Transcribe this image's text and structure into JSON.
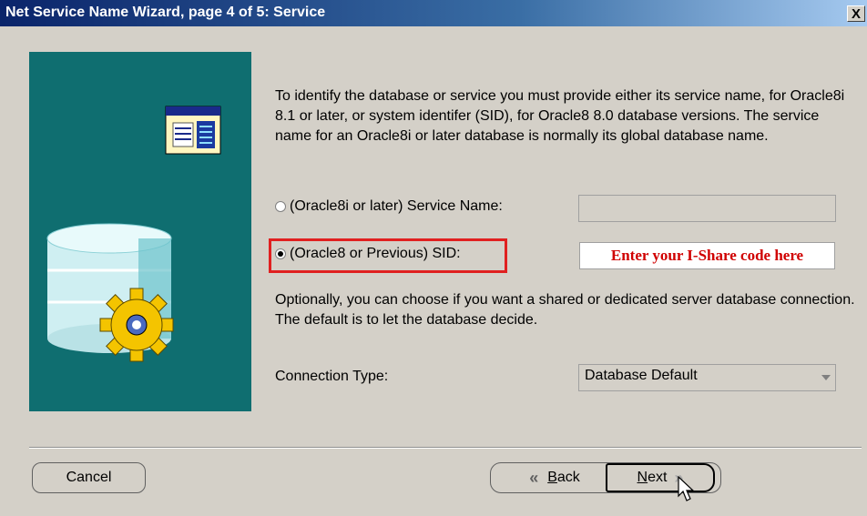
{
  "window": {
    "title": "Net Service Name Wizard, page 4 of 5: Service",
    "close_label": "X"
  },
  "intro": {
    "text": "To identify the database or service you must provide either its service name, for Oracle8i 8.1 or later, or system identifer (SID), for Oracle8 8.0 database versions. The service name for an Oracle8i or later database is normally its global database name."
  },
  "service_name": {
    "label": "(Oracle8i or later)  Service Name:",
    "selected": false,
    "value": ""
  },
  "sid": {
    "label": "(Oracle8 or Previous) SID:",
    "selected": true,
    "value": "Enter your I-Share code here"
  },
  "optional": {
    "text": "Optionally, you can choose if you want a shared or dedicated server database connection. The default is to let the database decide."
  },
  "connection_type": {
    "label": "Connection Type:",
    "selected": "Database Default"
  },
  "buttons": {
    "cancel": "Cancel",
    "back": "Back",
    "back_underline": "B",
    "back_rest": "ack",
    "next": "Next",
    "next_underline": "N",
    "next_rest": "ext"
  },
  "colors": {
    "art_background": "#0f6e70",
    "highlight": "#e02020",
    "sid_text": "#d00000"
  },
  "icons": [
    "close-icon",
    "document-icon",
    "database-icon",
    "gear-icon",
    "chevron-left-icon",
    "chevron-right-icon",
    "mouse-cursor-icon",
    "dropdown-arrow-icon"
  ]
}
